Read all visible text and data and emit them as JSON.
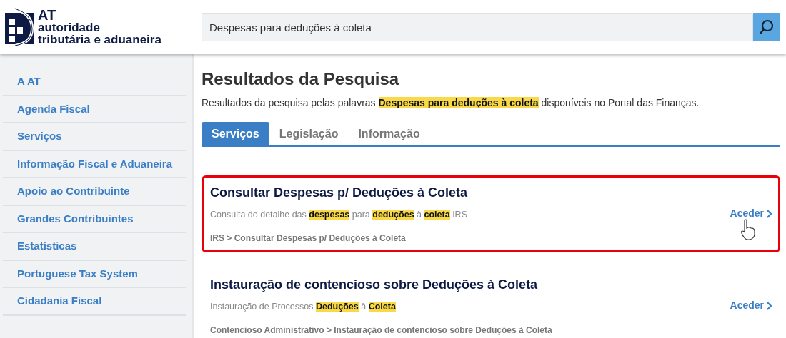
{
  "logo": {
    "lines": [
      "AT",
      "autoridade",
      "tributária e aduaneira"
    ]
  },
  "search": {
    "value": "Despesas para deduções à coleta"
  },
  "sidebar": {
    "items": [
      "A AT",
      "Agenda Fiscal",
      "Serviços",
      "Informação Fiscal e Aduaneira",
      "Apoio ao Contribuinte",
      "Grandes Contribuintes",
      "Estatísticas",
      "Portuguese Tax System",
      "Cidadania Fiscal"
    ]
  },
  "page": {
    "title": "Resultados da Pesquisa",
    "intro": [
      {
        "text": "Resultados da pesquisa pelas palavras ",
        "highlighted": false
      },
      {
        "text": "Despesas para deduções à coleta",
        "highlighted": true
      },
      {
        "text": " disponíveis no Portal das Finanças.",
        "highlighted": false
      }
    ]
  },
  "tabs": [
    {
      "label": "Serviços",
      "selected": true
    },
    {
      "label": "Legislação",
      "selected": false
    },
    {
      "label": "Informação",
      "selected": false
    }
  ],
  "results": [
    {
      "title": "Consultar Despesas p/ Deduções à Coleta",
      "outlined": true,
      "description": [
        {
          "text": "Consulta do detalhe das ",
          "highlighted": false
        },
        {
          "text": "despesas",
          "highlighted": true
        },
        {
          "text": " para ",
          "highlighted": false
        },
        {
          "text": "deduções",
          "highlighted": true
        },
        {
          "text": " à ",
          "highlighted": false
        },
        {
          "text": "coleta",
          "highlighted": true
        },
        {
          "text": " IRS",
          "highlighted": false
        }
      ],
      "path": "IRS > Consultar Despesas p/ Deduções à Coleta",
      "link": "Aceder",
      "hovered": true
    },
    {
      "title": "Instauração de contencioso sobre Deduções à Coleta",
      "outlined": false,
      "description": [
        {
          "text": "Instauração de Processos ",
          "highlighted": false
        },
        {
          "text": "Deduções",
          "highlighted": true
        },
        {
          "text": " à ",
          "highlighted": false
        },
        {
          "text": "Coleta",
          "highlighted": true
        }
      ],
      "path": "Contencioso Administrativo > Instauração de contencioso sobre Deduções à Coleta",
      "link": "Aceder",
      "hovered": false
    }
  ]
}
